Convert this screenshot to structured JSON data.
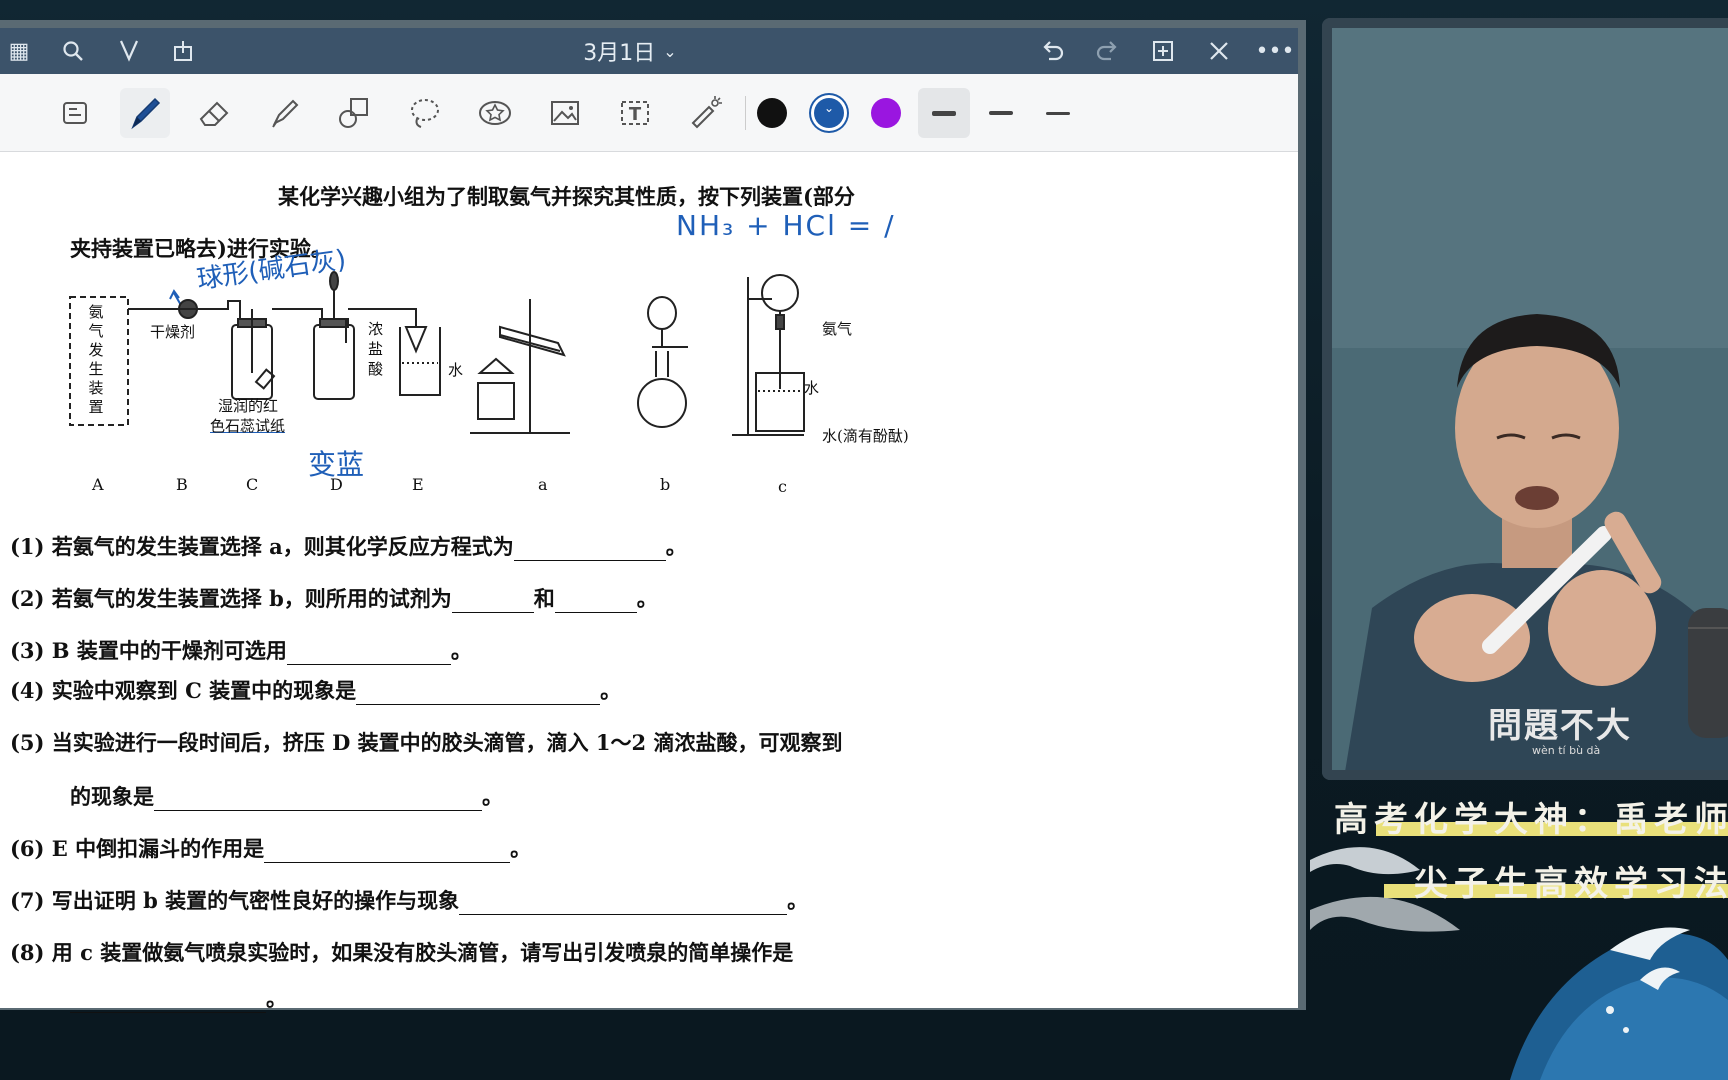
{
  "app": {
    "title": "3月1日",
    "title_chevron": "⌄",
    "topbar_icons": [
      "grid-icon",
      "search-icon",
      "bookmark-icon",
      "share-icon",
      "undo-icon",
      "redo-icon",
      "add-page-icon",
      "close-icon",
      "more-icon"
    ],
    "tools": [
      "lasso-convert-icon",
      "pen-icon",
      "eraser-icon",
      "highlighter-icon",
      "shapes-icon",
      "lasso-icon",
      "sticker-icon",
      "image-icon",
      "text-icon",
      "laser-pointer-icon"
    ],
    "colors": [
      "#111111",
      "#1e5aa8",
      "#9a16e0"
    ],
    "text_tool_label": "T"
  },
  "question": {
    "intro_line1": "某化学兴趣小组为了制取氨气并探究其性质，按下列装置(部分",
    "intro_line2": "夹持装置已略去)进行实验。",
    "figure_labels": {
      "A_box": "氨气发生装置",
      "drying_agent": "干燥剂",
      "litmus_line1": "湿润的红",
      "litmus_line2": "色石蕊试纸",
      "conc_hcl": "浓盐酸",
      "water_e": "水",
      "ammonia_c": "氨气",
      "water_c1": "水",
      "water_c2": "水(滴有酚酞)",
      "apparatus": [
        "A",
        "B",
        "C",
        "D",
        "E"
      ],
      "options": [
        "a",
        "b",
        "c"
      ]
    },
    "items": [
      {
        "prefix": "(1) 若氨气的发生装置选择 a，则其化学反应方程式为",
        "suffix": "。"
      },
      {
        "prefix": "(2) 若氨气的发生装置选择 b，则所用的试剂为",
        "mid": "和",
        "suffix": "。"
      },
      {
        "prefix": "(3) B 装置中的干燥剂可选用",
        "suffix": "。"
      },
      {
        "prefix": "(4) 实验中观察到 C 装置中的现象是",
        "suffix": "。"
      },
      {
        "prefix": "(5) 当实验进行一段时间后，挤压 D 装置中的胶头滴管，滴入 1～2 滴浓盐酸，可观察到",
        "line2": "的现象是",
        "suffix": "。"
      },
      {
        "prefix": "(6) E 中倒扣漏斗的作用是",
        "suffix": "。"
      },
      {
        "prefix": "(7) 写出证明 b 装置的气密性良好的操作与现象",
        "suffix": "。"
      },
      {
        "prefix": "(8) 用 c 装置做氨气喷泉实验时，如果没有胶头滴管，请写出引发喷泉的简单操作是",
        "suffix": "。"
      }
    ]
  },
  "handwriting": {
    "equation": "NH₃ + HCl = /",
    "note_b": "球形(碱石灰)",
    "note_c": "变蓝"
  },
  "video": {
    "cup_text": "問題不大",
    "cup_subtext": "wèn tí bù dà",
    "banner_line1": "高考化学大神：禹老师",
    "banner_line2": "尖子生高效学习法"
  }
}
